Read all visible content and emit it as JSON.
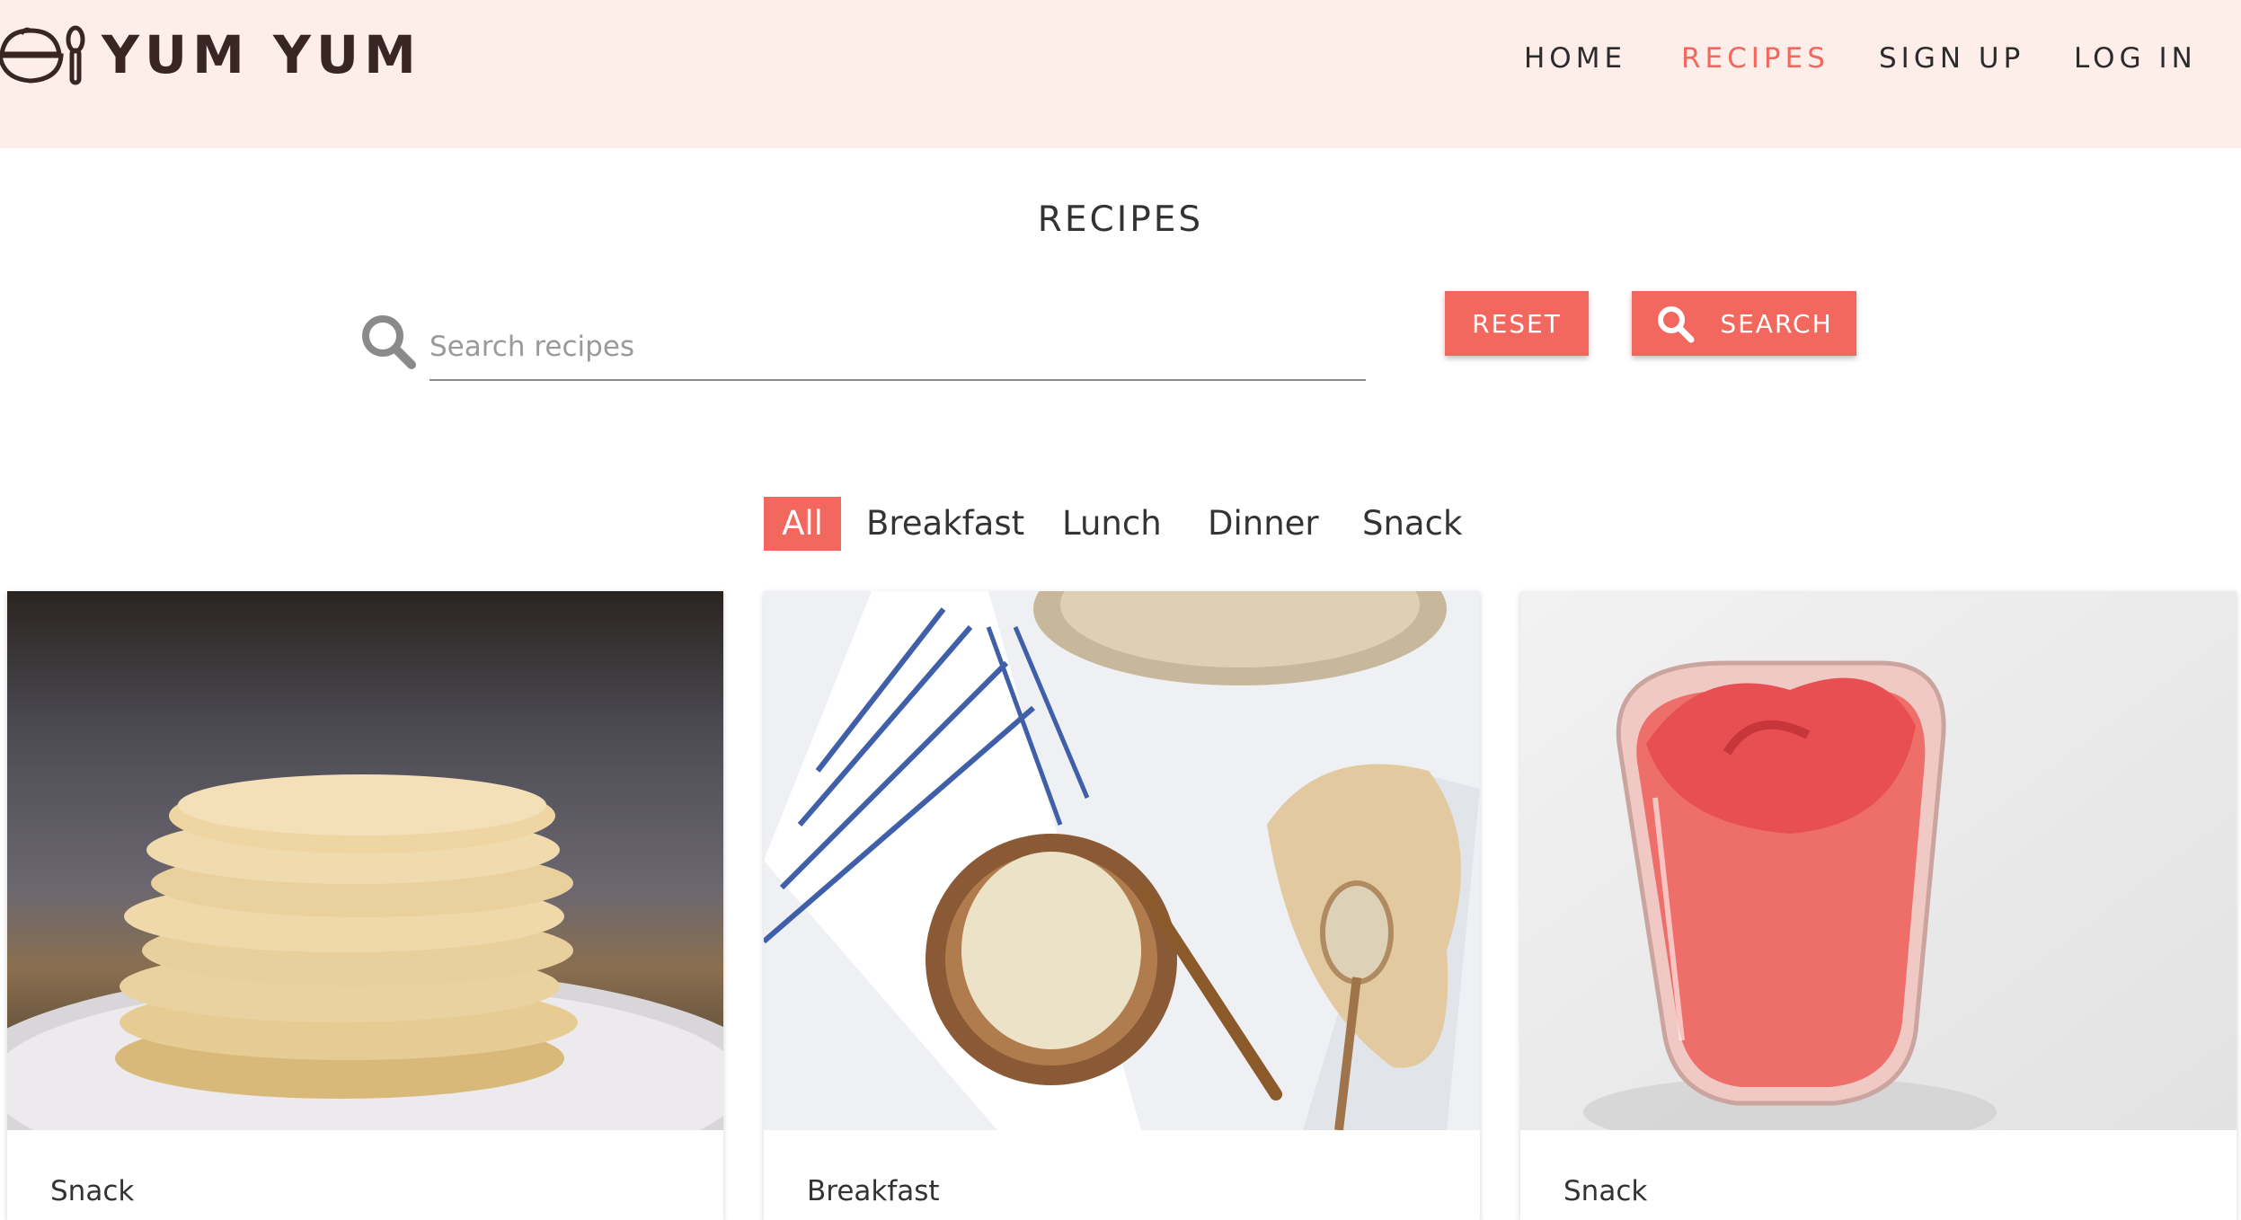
{
  "header": {
    "brand": "YUM YUM",
    "nav": [
      {
        "label": "HOME",
        "active": false
      },
      {
        "label": "RECIPES",
        "active": true
      },
      {
        "label": "SIGN UP",
        "active": false
      },
      {
        "label": "LOG IN",
        "active": false
      }
    ]
  },
  "page": {
    "title": "RECIPES"
  },
  "search": {
    "placeholder": "Search recipes",
    "value": "",
    "reset_label": "RESET",
    "search_label": "SEARCH"
  },
  "filters": [
    {
      "label": "All",
      "active": true
    },
    {
      "label": "Breakfast",
      "active": false
    },
    {
      "label": "Lunch",
      "active": false
    },
    {
      "label": "Dinner",
      "active": false
    },
    {
      "label": "Snack",
      "active": false
    }
  ],
  "cards": [
    {
      "category": "Snack",
      "image": "pancakes-photo"
    },
    {
      "category": "Breakfast",
      "image": "oatmeal-photo"
    },
    {
      "category": "Snack",
      "image": "smoothie-photo"
    }
  ],
  "colors": {
    "accent": "#f2685f",
    "header_bg": "#fdeeea",
    "text": "#2b2b2b"
  }
}
